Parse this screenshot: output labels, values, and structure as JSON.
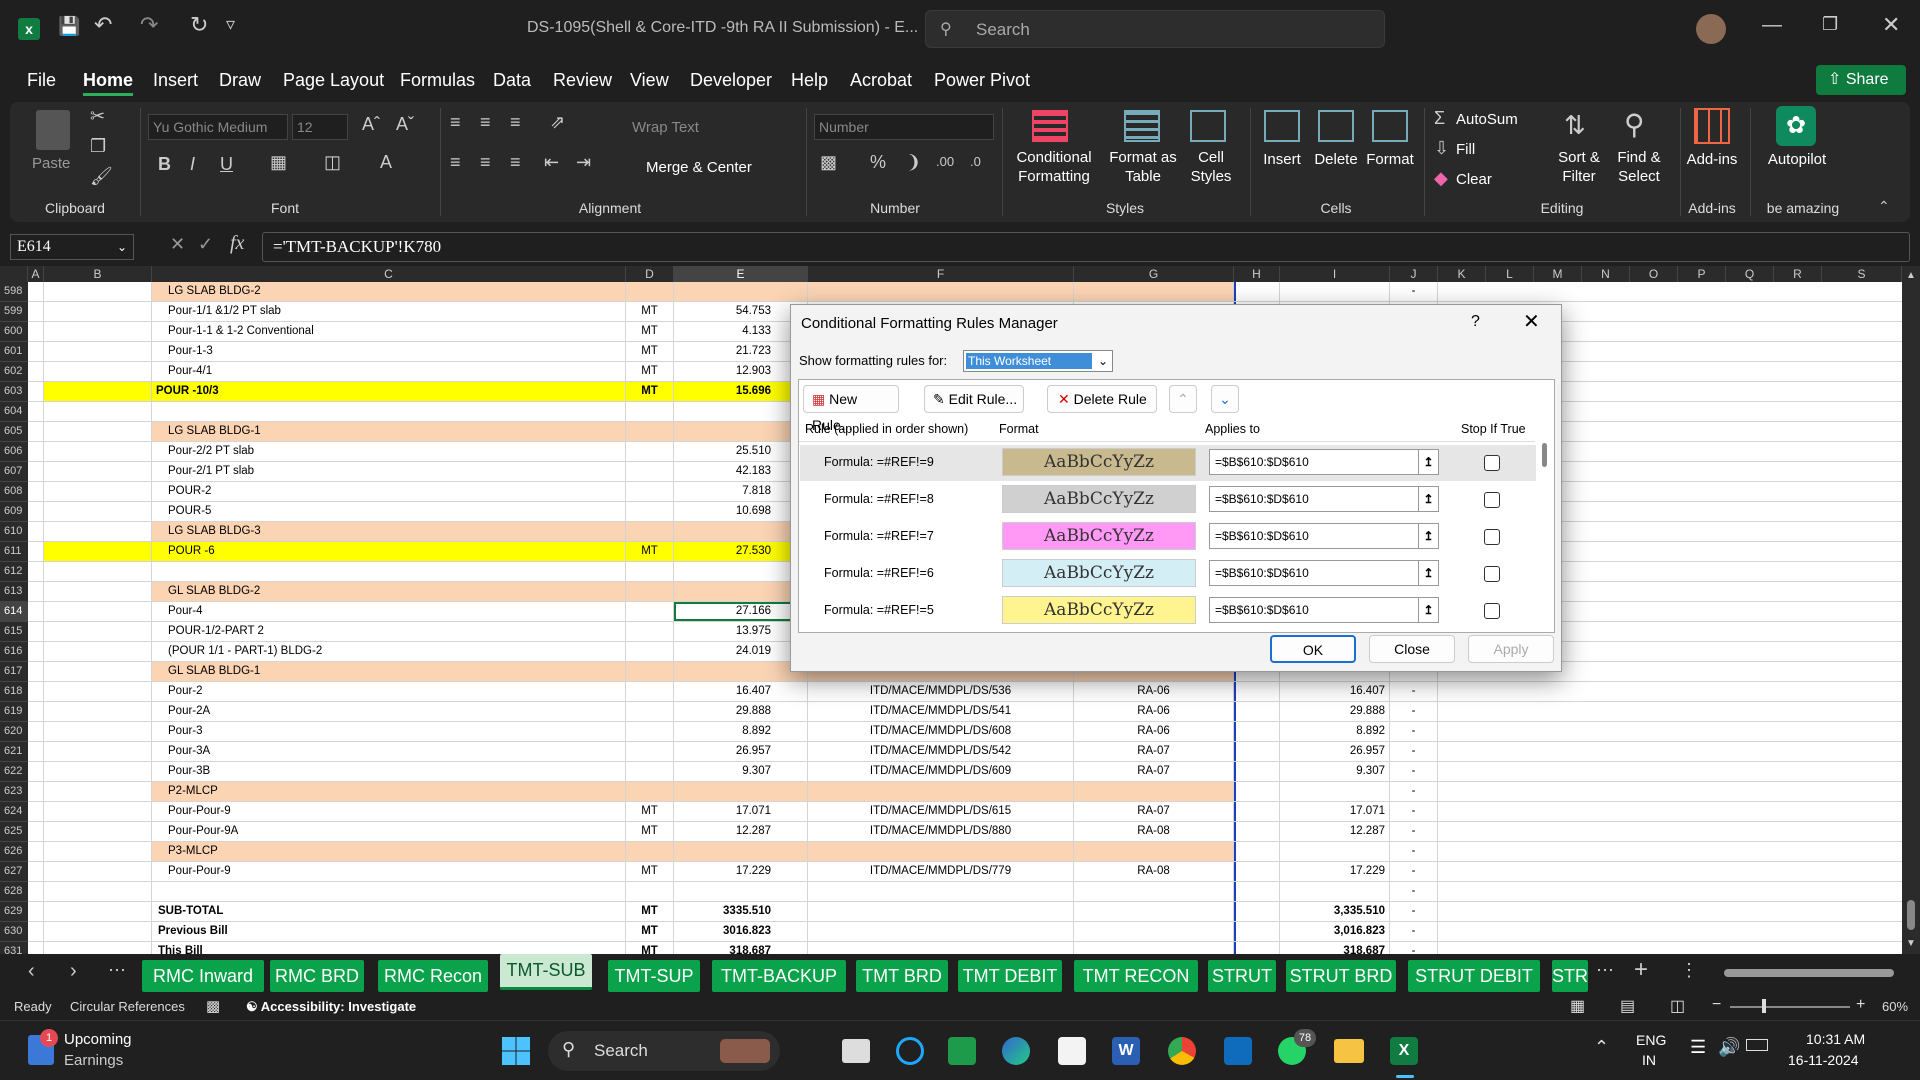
{
  "window": {
    "title": "DS-1095(Shell & Core-ITD -9th RA II Submission)  -  E...",
    "search_placeholder": "Search"
  },
  "menu": [
    "File",
    "Home",
    "Insert",
    "Draw",
    "Page Layout",
    "Formulas",
    "Data",
    "Review",
    "View",
    "Developer",
    "Help",
    "Acrobat",
    "Power Pivot"
  ],
  "share_label": "Share",
  "ribbon": {
    "paste": "Paste",
    "font_name": "Yu Gothic Medium",
    "font_size": "12",
    "wrap_text": "Wrap Text",
    "merge_center": "Merge & Center",
    "number_format": "Number",
    "conditional_formatting": [
      "Conditional",
      "Formatting"
    ],
    "format_as_table": [
      "Format as",
      "Table"
    ],
    "cell_styles": [
      "Cell",
      "Styles"
    ],
    "insert": "Insert",
    "delete": "Delete",
    "format": "Format",
    "autosum": "AutoSum",
    "fill": "Fill",
    "clear": "Clear",
    "sort_filter": [
      "Sort &",
      "Filter"
    ],
    "find_select": [
      "Find &",
      "Select"
    ],
    "addins": "Add-ins",
    "autopilot": "Autopilot",
    "groups": {
      "clipboard": "Clipboard",
      "font": "Font",
      "alignment": "Alignment",
      "number": "Number",
      "styles": "Styles",
      "cells": "Cells",
      "editing": "Editing",
      "addins": "Add-ins",
      "amazing": "be amazing"
    }
  },
  "formula_bar": {
    "name_box": "E614",
    "formula": "='TMT-BACKUP'!K780"
  },
  "columns": [
    "A",
    "B",
    "C",
    "D",
    "E",
    "F",
    "G",
    "H",
    "I",
    "J",
    "K",
    "L",
    "M",
    "N",
    "O",
    "P",
    "Q",
    "R",
    "S"
  ],
  "rows": [
    {
      "n": "598",
      "c": "LG SLAB BLDG-2",
      "d": "",
      "e": "",
      "f": "",
      "g": "",
      "i": "",
      "style": "salmon"
    },
    {
      "n": "599",
      "c": "Pour-1/1 &1/2 PT slab",
      "d": "MT",
      "e": "54.753",
      "f": "",
      "g": "",
      "i": "",
      "style": ""
    },
    {
      "n": "600",
      "c": "Pour-1-1 & 1-2 Conventional",
      "d": "MT",
      "e": "4.133",
      "f": "",
      "g": "",
      "i": "",
      "style": ""
    },
    {
      "n": "601",
      "c": "Pour-1-3",
      "d": "MT",
      "e": "21.723",
      "f": "",
      "g": "",
      "i": "",
      "style": ""
    },
    {
      "n": "602",
      "c": "Pour-4/1",
      "d": "MT",
      "e": "12.903",
      "f": "",
      "g": "",
      "i": "",
      "style": ""
    },
    {
      "n": "603",
      "c": "POUR -10/3",
      "d": "MT",
      "e": "15.696",
      "f": "",
      "g": "",
      "i": "",
      "style": "yellowbold"
    },
    {
      "n": "604",
      "c": "",
      "d": "",
      "e": "",
      "f": "",
      "g": "",
      "i": "",
      "style": ""
    },
    {
      "n": "605",
      "c": "LG SLAB BLDG-1",
      "d": "",
      "e": "",
      "f": "",
      "g": "",
      "i": "",
      "style": "salmon"
    },
    {
      "n": "606",
      "c": "Pour-2/2 PT slab",
      "d": "",
      "e": "25.510",
      "f": "",
      "g": "",
      "i": "",
      "style": ""
    },
    {
      "n": "607",
      "c": "Pour-2/1 PT slab",
      "d": "",
      "e": "42.183",
      "f": "",
      "g": "",
      "i": "",
      "style": ""
    },
    {
      "n": "608",
      "c": "POUR-2",
      "d": "",
      "e": "7.818",
      "f": "",
      "g": "",
      "i": "",
      "style": ""
    },
    {
      "n": "609",
      "c": "POUR-5",
      "d": "",
      "e": "10.698",
      "f": "",
      "g": "",
      "i": "",
      "style": ""
    },
    {
      "n": "610",
      "c": "LG SLAB BLDG-3",
      "d": "",
      "e": "",
      "f": "",
      "g": "",
      "i": "",
      "style": "salmon"
    },
    {
      "n": "611",
      "c": "POUR -6",
      "d": "MT",
      "e": "27.530",
      "f": "",
      "g": "",
      "i": "",
      "style": "yellow"
    },
    {
      "n": "612",
      "c": "",
      "d": "",
      "e": "",
      "f": "",
      "g": "",
      "i": "",
      "style": ""
    },
    {
      "n": "613",
      "c": "GL SLAB BLDG-2",
      "d": "",
      "e": "",
      "f": "",
      "g": "",
      "i": "",
      "style": "salmon"
    },
    {
      "n": "614",
      "c": "Pour-4",
      "d": "",
      "e": "27.166",
      "f": "",
      "g": "",
      "i": "",
      "style": "selected"
    },
    {
      "n": "615",
      "c": "POUR-1/2-PART 2",
      "d": "",
      "e": "13.975",
      "f": "",
      "g": "",
      "i": "",
      "style": ""
    },
    {
      "n": "616",
      "c": "(POUR 1/1 - PART-1) BLDG-2",
      "d": "",
      "e": "24.019",
      "f": "",
      "g": "",
      "i": "",
      "style": ""
    },
    {
      "n": "617",
      "c": "GL SLAB BLDG-1",
      "d": "",
      "e": "",
      "f": "",
      "g": "",
      "i": "",
      "style": "salmon"
    },
    {
      "n": "618",
      "c": "Pour-2",
      "d": "",
      "e": "16.407",
      "f": "ITD/MACE/MMDPL/DS/536",
      "g": "RA-06",
      "i": "16.407",
      "style": ""
    },
    {
      "n": "619",
      "c": "Pour-2A",
      "d": "",
      "e": "29.888",
      "f": "ITD/MACE/MMDPL/DS/541",
      "g": "RA-06",
      "i": "29.888",
      "style": ""
    },
    {
      "n": "620",
      "c": "Pour-3",
      "d": "",
      "e": "8.892",
      "f": "ITD/MACE/MMDPL/DS/608",
      "g": "RA-06",
      "i": "8.892",
      "style": ""
    },
    {
      "n": "621",
      "c": "Pour-3A",
      "d": "",
      "e": "26.957",
      "f": "ITD/MACE/MMDPL/DS/542",
      "g": "RA-07",
      "i": "26.957",
      "style": ""
    },
    {
      "n": "622",
      "c": "Pour-3B",
      "d": "",
      "e": "9.307",
      "f": "ITD/MACE/MMDPL/DS/609",
      "g": "RA-07",
      "i": "9.307",
      "style": ""
    },
    {
      "n": "623",
      "c": "P2-MLCP",
      "d": "",
      "e": "",
      "f": "",
      "g": "",
      "i": "",
      "style": "salmon"
    },
    {
      "n": "624",
      "c": "Pour-Pour-9",
      "d": "MT",
      "e": "17.071",
      "f": "ITD/MACE/MMDPL/DS/615",
      "g": "RA-07",
      "i": "17.071",
      "style": ""
    },
    {
      "n": "625",
      "c": "Pour-Pour-9A",
      "d": "MT",
      "e": "12.287",
      "f": "ITD/MACE/MMDPL/DS/880",
      "g": "RA-08",
      "i": "12.287",
      "style": ""
    },
    {
      "n": "626",
      "c": "P3-MLCP",
      "d": "",
      "e": "",
      "f": "",
      "g": "",
      "i": "",
      "style": "salmon"
    },
    {
      "n": "627",
      "c": "Pour-Pour-9",
      "d": "MT",
      "e": "17.229",
      "f": "ITD/MACE/MMDPL/DS/779",
      "g": "RA-08",
      "i": "17.229",
      "style": ""
    },
    {
      "n": "628",
      "c": "",
      "d": "",
      "e": "",
      "f": "",
      "g": "",
      "i": "",
      "style": ""
    },
    {
      "n": "629",
      "c": "SUB-TOTAL",
      "d": "MT",
      "e": "3335.510",
      "f": "",
      "g": "",
      "i": "3,335.510",
      "style": "bold"
    },
    {
      "n": "630",
      "c": "Previous Bill",
      "d": "MT",
      "e": "3016.823",
      "f": "",
      "g": "",
      "i": "3,016.823",
      "style": "bold"
    },
    {
      "n": "631",
      "c": "This Bill",
      "d": "MT",
      "e": "318.687",
      "f": "",
      "g": "",
      "i": "318.687",
      "style": "bold"
    }
  ],
  "dialog": {
    "title": "Conditional Formatting Rules Manager",
    "help": "?",
    "show_for_label": "Show formatting rules for:",
    "show_for_value": "This Worksheet",
    "new_rule": "New Rule...",
    "edit_rule": "Edit Rule...",
    "delete_rule": "Delete Rule",
    "headers": {
      "rule": "Rule (applied in order shown)",
      "format": "Format",
      "applies": "Applies to",
      "stop": "Stop If True"
    },
    "rules": [
      {
        "rule": "Formula: =#REF!=9",
        "sample": "AaBbCcYyZz",
        "color": "#c9b98f",
        "applies": "=$B$610:$D$610"
      },
      {
        "rule": "Formula: =#REF!=8",
        "sample": "AaBbCcYyZz",
        "color": "#d0d0d0",
        "applies": "=$B$610:$D$610"
      },
      {
        "rule": "Formula: =#REF!=7",
        "sample": "AaBbCcYyZz",
        "color": "#ff99f5",
        "applies": "=$B$610:$D$610"
      },
      {
        "rule": "Formula: =#REF!=6",
        "sample": "AaBbCcYyZz",
        "color": "#d3eef4",
        "applies": "=$B$610:$D$610"
      },
      {
        "rule": "Formula: =#REF!=5",
        "sample": "AaBbCcYyZz",
        "color": "#fff48f",
        "applies": "=$B$610:$D$610"
      }
    ],
    "ok": "OK",
    "close": "Close",
    "apply": "Apply"
  },
  "sheet_tabs": [
    "RMC Inward",
    "RMC BRD",
    "RMC Recon",
    "TMT-SUB",
    "TMT-SUP",
    "TMT-BACKUP",
    "TMT BRD",
    "TMT DEBIT",
    "TMT RECON",
    "STRUT",
    "STRUT BRD",
    "STRUT DEBIT",
    "STR"
  ],
  "active_tab": "TMT-SUB",
  "status": {
    "ready": "Ready",
    "circular": "Circular References",
    "accessibility": "Accessibility: Investigate",
    "zoom": "60%"
  },
  "taskbar": {
    "widget_title": "Upcoming",
    "widget_sub": "Earnings",
    "widget_badge": "1",
    "search": "Search",
    "whatsapp_badge": "78",
    "lang1": "ENG",
    "lang2": "IN",
    "time": "10:31 AM",
    "date": "16-11-2024"
  },
  "colors": {
    "salmon": "#fbd4b4",
    "yellow": "#ffff00",
    "tab_green": "#0aa24a",
    "accent": "#0f7b3f"
  }
}
